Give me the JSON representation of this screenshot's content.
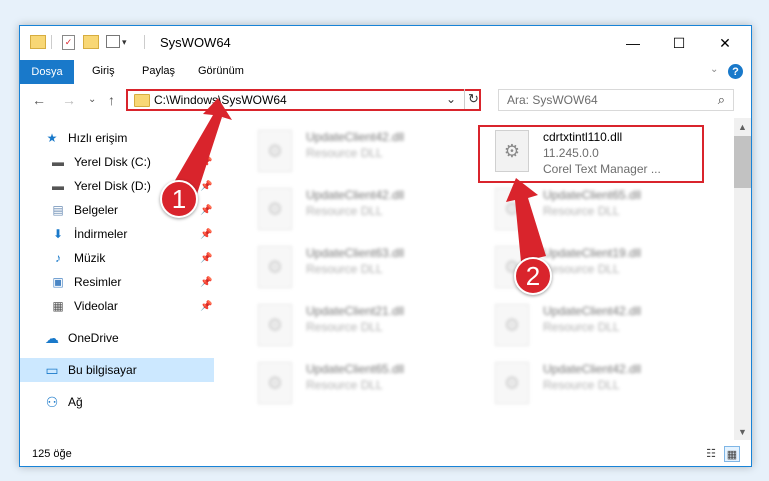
{
  "window": {
    "title": "SysWOW64",
    "buttons": {
      "minimize": "—",
      "maximize": "☐",
      "close": "✕"
    }
  },
  "ribbon": {
    "tabs": [
      "Dosya",
      "Giriş",
      "Paylaş",
      "Görünüm"
    ],
    "expand_glyph": "⌄",
    "help_glyph": "?"
  },
  "nav": {
    "back": "←",
    "forward": "→",
    "recent": "⌄",
    "up": "↑",
    "address": "C:\\Windows\\SysWOW64",
    "address_dropdown": "⌄",
    "refresh": "↻",
    "search_placeholder": "Ara: SysWOW64",
    "search_glyph": "⌕"
  },
  "sidebar": {
    "items": [
      {
        "label": "Hızlı erişim",
        "icon": "star-icon",
        "glyph": "★",
        "pinned": false
      },
      {
        "label": "Yerel Disk (C:)",
        "icon": "drive-icon",
        "glyph": "▬",
        "pinned": true
      },
      {
        "label": "Yerel Disk (D:)",
        "icon": "drive-icon",
        "glyph": "▬",
        "pinned": true
      },
      {
        "label": "Belgeler",
        "icon": "documents-icon",
        "glyph": "▤",
        "pinned": true
      },
      {
        "label": "İndirmeler",
        "icon": "download-icon",
        "glyph": "⬇",
        "pinned": true
      },
      {
        "label": "Müzik",
        "icon": "music-icon",
        "glyph": "♪",
        "pinned": true
      },
      {
        "label": "Resimler",
        "icon": "pictures-icon",
        "glyph": "▣",
        "pinned": true
      },
      {
        "label": "Videolar",
        "icon": "video-icon",
        "glyph": "▦",
        "pinned": true
      },
      {
        "label": "OneDrive",
        "icon": "cloud-icon",
        "glyph": "☁",
        "pinned": false
      },
      {
        "label": "Bu bilgisayar",
        "icon": "computer-icon",
        "glyph": "▭",
        "pinned": false,
        "selected": true
      },
      {
        "label": "Ağ",
        "icon": "network-icon",
        "glyph": "⚇",
        "pinned": false
      }
    ],
    "pin_glyph": "📌"
  },
  "files": {
    "highlighted": {
      "name": "cdrtxtintl110.dll",
      "version": "11.245.0.0",
      "description": "Corel Text Manager ..."
    },
    "left_column": [
      {
        "name": "UpdateClient42.dll",
        "type": "Resource DLL"
      },
      {
        "name": "UpdateClient42.dll",
        "type": "Resource DLL"
      },
      {
        "name": "UpdateClient63.dll",
        "type": "Resource DLL"
      },
      {
        "name": "UpdateClient21.dll",
        "type": "Resource DLL"
      },
      {
        "name": "UpdateClient65.dll",
        "type": "Resource DLL"
      }
    ],
    "right_column": [
      {
        "name": "UpdateClient65.dll",
        "type": "Resource DLL"
      },
      {
        "name": "UpdateClient19.dll",
        "type": "Resource DLL"
      },
      {
        "name": "UpdateClient42.dll",
        "type": "Resource DLL"
      },
      {
        "name": "UpdateClient42.dll",
        "type": "Resource DLL"
      }
    ],
    "file_glyph": "⚙"
  },
  "status": {
    "count": "125 öğe"
  },
  "annotations": {
    "step1": "1",
    "step2": "2",
    "color": "#d9242c"
  }
}
